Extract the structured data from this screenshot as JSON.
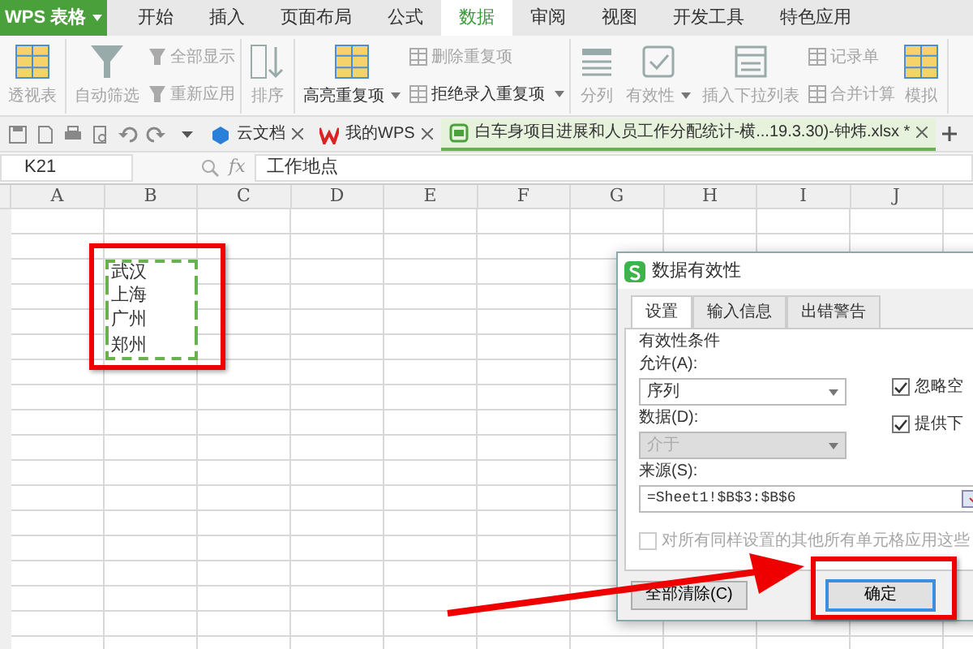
{
  "app_button": {
    "label": "WPS 表格"
  },
  "menu_tabs": [
    {
      "label": "开始",
      "selected": false
    },
    {
      "label": "插入",
      "selected": false
    },
    {
      "label": "页面布局",
      "selected": false
    },
    {
      "label": "公式",
      "selected": false
    },
    {
      "label": "数据",
      "selected": true
    },
    {
      "label": "审阅",
      "selected": false
    },
    {
      "label": "视图",
      "selected": false
    },
    {
      "label": "开发工具",
      "selected": false
    },
    {
      "label": "特色应用",
      "selected": false
    }
  ],
  "ribbon": {
    "groups": [
      {
        "items": [
          {
            "label": "透视表",
            "kind": "large",
            "disabled": true,
            "dropdown": false
          }
        ]
      },
      {
        "items": [
          {
            "label": "自动筛选",
            "kind": "large",
            "disabled": true,
            "dropdown": false
          },
          {
            "label": "全部显示",
            "kind": "small",
            "disabled": true,
            "dropdown": false
          },
          {
            "label": "重新应用",
            "kind": "small",
            "disabled": true,
            "dropdown": false
          }
        ]
      },
      {
        "items": [
          {
            "label": "排序",
            "kind": "large",
            "disabled": true,
            "dropdown": false
          }
        ]
      },
      {
        "items": [
          {
            "label": "高亮重复项",
            "kind": "large",
            "disabled": false,
            "dropdown": true
          },
          {
            "label": "删除重复项",
            "kind": "small",
            "disabled": true,
            "dropdown": false
          },
          {
            "label": "拒绝录入重复项",
            "kind": "small",
            "disabled": false,
            "dropdown": true
          }
        ]
      },
      {
        "items": [
          {
            "label": "分列",
            "kind": "large",
            "disabled": true,
            "dropdown": false
          },
          {
            "label": "有效性",
            "kind": "large",
            "disabled": true,
            "dropdown": true
          },
          {
            "label": "插入下拉列表",
            "kind": "large",
            "disabled": true,
            "dropdown": false
          },
          {
            "label": "记录单",
            "kind": "small",
            "disabled": true,
            "dropdown": false
          },
          {
            "label": "合并计算",
            "kind": "small",
            "disabled": true,
            "dropdown": false
          },
          {
            "label": "模拟",
            "kind": "large",
            "disabled": true,
            "dropdown": false
          }
        ]
      }
    ]
  },
  "doc_tabs": [
    {
      "label": "云文档",
      "kind": "cloud",
      "selected": false
    },
    {
      "label": "我的WPS",
      "kind": "wps",
      "selected": false
    },
    {
      "label": "白车身项目进展和人员工作分配统计-横...19.3.30)-钟炜.xlsx *",
      "kind": "sheet",
      "selected": true
    }
  ],
  "formula_bar": {
    "cell_ref": "K21",
    "fx": "fx",
    "content": "工作地点"
  },
  "sheet": {
    "columns": [
      "A",
      "B",
      "C",
      "D",
      "E",
      "F",
      "G",
      "H",
      "I",
      "J"
    ],
    "range_values": [
      "武汉",
      "上海",
      "广州",
      "郑州"
    ]
  },
  "dialog": {
    "title": "数据有效性",
    "tabs": [
      {
        "label": "设置",
        "selected": true
      },
      {
        "label": "输入信息",
        "selected": false
      },
      {
        "label": "出错警告",
        "selected": false
      }
    ],
    "criteria_label": "有效性条件",
    "fields": [
      {
        "label": "允许(A):",
        "value": "序列",
        "kind": "select",
        "disabled": false
      },
      {
        "label": "数据(D):",
        "value": "介于",
        "kind": "select",
        "disabled": true
      },
      {
        "label": "来源(S):",
        "value": "=Sheet1!$B$3:$B$6",
        "kind": "input"
      }
    ],
    "options": [
      {
        "label": "忽略空",
        "checked": true,
        "disabled": false
      },
      {
        "label": "提供下",
        "checked": true,
        "disabled": false
      }
    ],
    "apply_all": {
      "label": "对所有同样设置的其他所有单元格应用这些",
      "checked": false,
      "disabled": true
    },
    "buttons": [
      {
        "label": "全部清除(C)",
        "default": false
      },
      {
        "label": "确定",
        "default": true
      }
    ]
  }
}
